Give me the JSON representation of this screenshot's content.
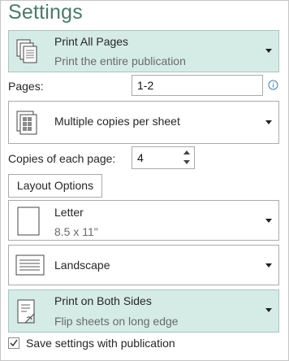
{
  "title": "Settings",
  "pages_dropdown": {
    "label": "Print All Pages",
    "sublabel": "Print the entire publication",
    "icon": "pages-stack-icon"
  },
  "pages_field": {
    "label": "Pages:",
    "value": "1-2",
    "info_icon": "info-icon"
  },
  "layout_dropdown": {
    "label": "Multiple copies per sheet",
    "icon": "grid-pages-icon"
  },
  "copies_field": {
    "label": "Copies of each page:",
    "value": "4"
  },
  "layout_options_button": {
    "label": "Layout Options"
  },
  "paper_dropdown": {
    "label": "Letter",
    "sublabel": "8.5 x 11\"",
    "icon": "paper-portrait-icon"
  },
  "orientation_dropdown": {
    "label": "Landscape",
    "icon": "landscape-page-icon"
  },
  "sides_dropdown": {
    "label": "Print on Both Sides",
    "sublabel": "Flip sheets on long edge",
    "icon": "duplex-page-icon"
  },
  "save_checkbox": {
    "label": "Save settings with publication",
    "checked": true
  },
  "colors": {
    "accent_text": "#4b7a6a",
    "selected_bg": "#d5ece6"
  }
}
